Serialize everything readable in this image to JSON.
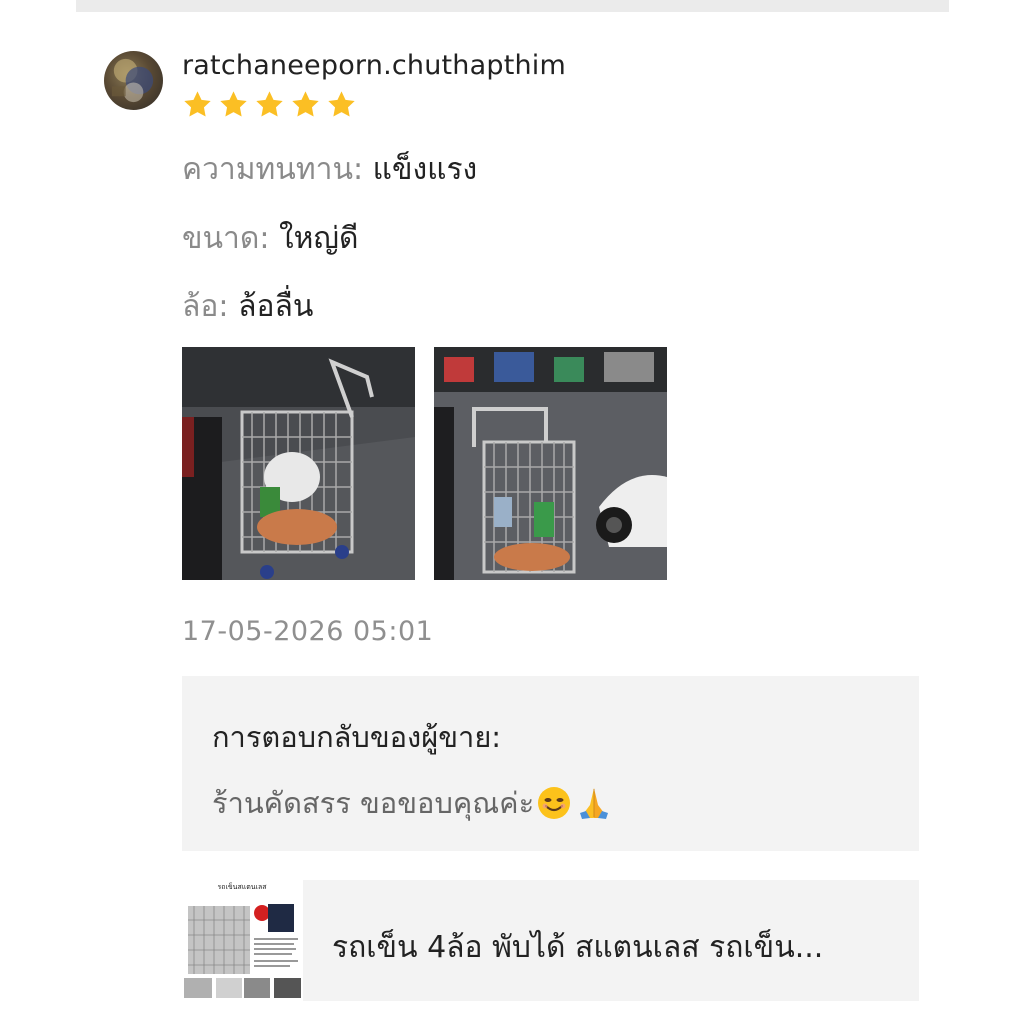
{
  "review": {
    "username": "ratchaneeporn.chuthapthim",
    "rating": 5,
    "attributes": [
      {
        "label": "ความทนทาน:",
        "value": "แข็งแรง"
      },
      {
        "label": "ขนาด:",
        "value": "ใหญ่ดี"
      },
      {
        "label": "ล้อ:",
        "value": "ล้อลื่น"
      }
    ],
    "timestamp": "17-05-2026 05:01"
  },
  "seller_reply": {
    "title": "การตอบกลับของผู้ขาย:",
    "text": "ร้านคัดสรร ขอขอบคุณค่ะ"
  },
  "product": {
    "title": "รถเข็น 4ล้อ พับได้ สแตนเลส รถเข็น...",
    "thumb_heading": "รถเข็นสแตนเลส"
  },
  "colors": {
    "star": "#fbbf24",
    "muted_text": "#8a8a8a",
    "panel_bg": "#f3f3f3"
  },
  "icons": [
    "star-icon",
    "smiling-face-emoji",
    "folded-hands-emoji"
  ]
}
